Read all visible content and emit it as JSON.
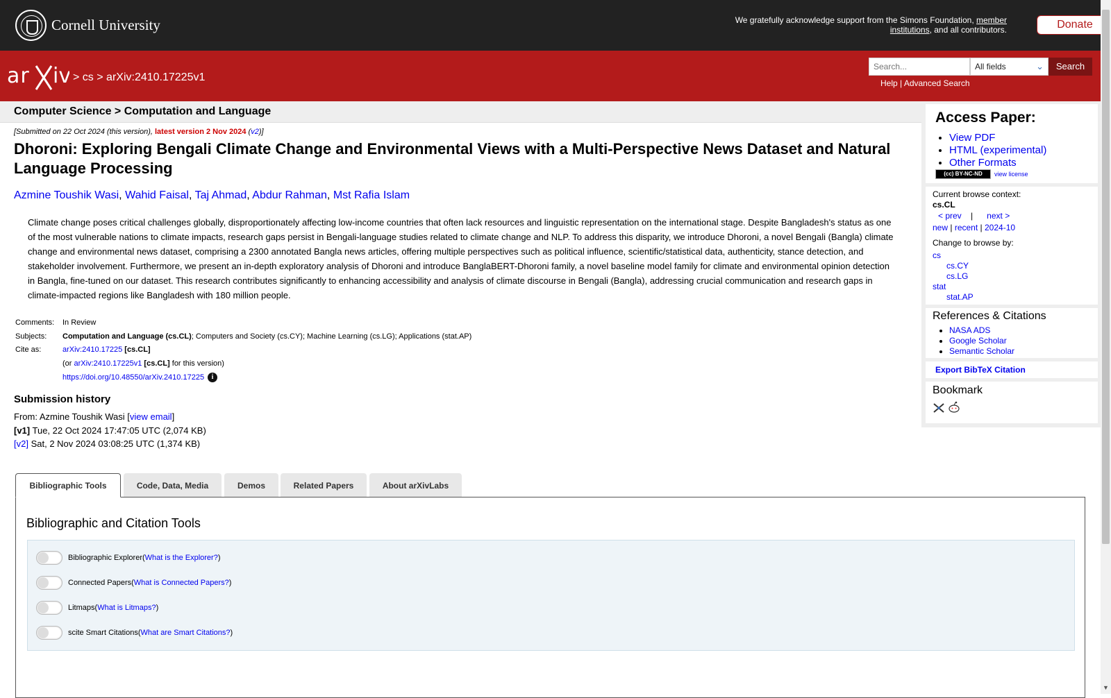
{
  "cornell": {
    "name": "Cornell University",
    "support_prefix": "We gratefully acknowledge support from the Simons Foundation, ",
    "support_link": "member institutions",
    "support_suffix": ", and all contributors.",
    "donate": "Donate"
  },
  "header": {
    "logo": "arXiv",
    "crumb_sep": ">",
    "crumb_cs": "cs",
    "crumb_id": "arXiv:2410.17225v1",
    "search_placeholder": "Search...",
    "search_field": "All fields",
    "search_button": "Search",
    "help": "Help",
    "help_sep": "|",
    "advanced": "Advanced Search"
  },
  "subject_heading": "Computer Science > Computation and Language",
  "dateline": {
    "prefix": "[Submitted on 22 Oct 2024 (this version), ",
    "latest": "latest version 2 Nov 2024",
    "v2": "v2",
    "open": " (",
    "close": ")]"
  },
  "title": "Dhoroni: Exploring Bengali Climate Change and Environmental Views with a Multi-Perspective News Dataset and Natural Language Processing",
  "authors": [
    "Azmine Toushik Wasi",
    "Wahid Faisal",
    "Taj Ahmad",
    "Abdur Rahman",
    "Mst Rafia Islam"
  ],
  "abstract": "Climate change poses critical challenges globally, disproportionately affecting low-income countries that often lack resources and linguistic representation on the international stage. Despite Bangladesh's status as one of the most vulnerable nations to climate impacts, research gaps persist in Bengali-language studies related to climate change and NLP. To address this disparity, we introduce Dhoroni, a novel Bengali (Bangla) climate change and environmental news dataset, comprising a 2300 annotated Bangla news articles, offering multiple perspectives such as political influence, scientific/statistical data, authenticity, stance detection, and stakeholder involvement. Furthermore, we present an in-depth exploratory analysis of Dhoroni and introduce BanglaBERT-Dhoroni family, a novel baseline model family for climate and environmental opinion detection in Bangla, fine-tuned on our dataset. This research contributes significantly to enhancing accessibility and analysis of climate discourse in Bengali (Bangla), addressing crucial communication and research gaps in climate-impacted regions like Bangladesh with 180 million people.",
  "meta": {
    "comments_label": "Comments:",
    "comments": "In Review",
    "subjects_label": "Subjects:",
    "subjects_primary": "Computation and Language (cs.CL)",
    "subjects_rest": "; Computers and Society (cs.CY); Machine Learning (cs.LG); Applications (stat.AP)",
    "cite_label": "Cite as:",
    "cite_id": "arXiv:2410.17225",
    "cite_cat": "[cs.CL]",
    "cite_or": "(or ",
    "cite_v1": "arXiv:2410.17225v1",
    "cite_v1_cat": "[cs.CL]",
    "cite_v1_suffix": " for this version)",
    "doi": "https://doi.org/10.48550/arXiv.2410.17225",
    "info": "i"
  },
  "history": {
    "title": "Submission history",
    "from_prefix": "From: Azmine Toushik Wasi [",
    "view_email": "view email",
    "from_suffix": "]",
    "v1_label": "[v1]",
    "v1_text": " Tue, 22 Oct 2024 17:47:05 UTC (2,074 KB)",
    "v2_label": "[v2]",
    "v2_text": " Sat, 2 Nov 2024 03:08:25 UTC (1,374 KB)"
  },
  "sidebar": {
    "access_title": "Access Paper:",
    "access_links": [
      "View PDF",
      "HTML (experimental)",
      "Other Formats"
    ],
    "cc_badge": "(cc) BY-NC-ND",
    "view_license": "view license",
    "context_label": "Current browse context:",
    "context_value": "cs.CL",
    "prev": "< prev",
    "nav_sep": "|",
    "next": "next >",
    "new": "new",
    "recent": "recent",
    "month": "2024-10",
    "change_label": "Change to browse by:",
    "browse_cs": "cs",
    "browse_cs_cy": "cs.CY",
    "browse_cs_lg": "cs.LG",
    "browse_stat": "stat",
    "browse_stat_ap": "stat.AP",
    "refs_title": "References & Citations",
    "refs": [
      "NASA ADS",
      "Google Scholar",
      "Semantic Scholar"
    ],
    "bibtex": "Export BibTeX Citation",
    "bookmark_title": "Bookmark"
  },
  "tabs": [
    "Bibliographic Tools",
    "Code, Data, Media",
    "Demos",
    "Related Papers",
    "About arXivLabs"
  ],
  "panel": {
    "title": "Bibliographic and Citation Tools",
    "tools": [
      {
        "label": "Bibliographic Explorer",
        "link": "What is the Explorer?"
      },
      {
        "label": "Connected Papers",
        "link": "What is Connected Papers?"
      },
      {
        "label": "Litmaps",
        "link": "What is Litmaps?"
      },
      {
        "label": "scite Smart Citations",
        "link": "What are Smart Citations?"
      }
    ],
    "open_paren": " (",
    "close_paren": ")"
  },
  "colors": {
    "arxiv_red": "#b31b1b",
    "cornell_dark": "#222222",
    "link_blue": "#0000ee"
  }
}
